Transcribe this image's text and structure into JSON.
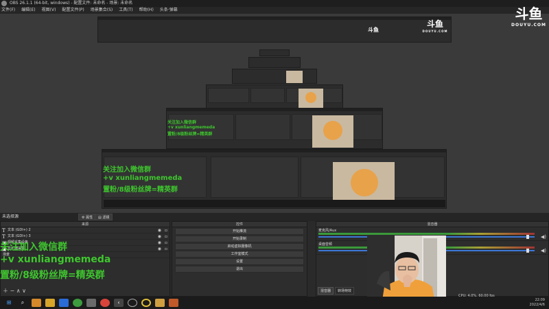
{
  "window": {
    "title": "OBS 26.1.1 (64-bit, windows) - 配置文件: 未命名 - 场景: 未命名"
  },
  "menu": [
    "文件(F)",
    "编辑(E)",
    "视图(V)",
    "配置文件(P)",
    "场景集合(S)",
    "工具(T)",
    "帮助(H)",
    "头条·弹幕"
  ],
  "brand": {
    "glyph": "斗鱼",
    "site": "DOUYU.COM"
  },
  "overlay": {
    "line1": "关注加入微信群",
    "line2": "+v xunliangmemeda",
    "line3": "置粉/8级粉丝牌=精英群"
  },
  "scene_bar": {
    "label": "未选择源",
    "properties_button": "属性",
    "filters_button": "滤镜"
  },
  "sources_dock": {
    "title": "来源",
    "items": [
      {
        "icon": "T",
        "label": "文本 (GDI+) 2"
      },
      {
        "icon": "T",
        "label": "文本 (GDI+) 3"
      },
      {
        "icon": "▣",
        "label": "视频采集设备"
      },
      {
        "icon": "▣",
        "label": "显示器采集"
      }
    ],
    "footer": "场景"
  },
  "controls_dock": {
    "title": "控件",
    "buttons": [
      "开始推流",
      "开始录制",
      "启动虚拟摄像机",
      "工作室模式",
      "设置",
      "退出"
    ]
  },
  "mixer_dock": {
    "title": "混音器",
    "tracks": [
      {
        "name": "麦克风/Aux",
        "level": 0.62
      },
      {
        "name": "桌面音频",
        "level": 0.55
      }
    ],
    "tabs": [
      "混音器",
      "转场特效"
    ]
  },
  "status": {
    "cpu": "CPU: 4.0%, 60.00 fps",
    "time": "22:09",
    "date": "2022/4/6",
    "input_label": "搜索"
  },
  "colors": {
    "overlay_green": "#3ec62e",
    "accent_blue": "#3c78d8",
    "meter_green": "#3a9a3a"
  }
}
